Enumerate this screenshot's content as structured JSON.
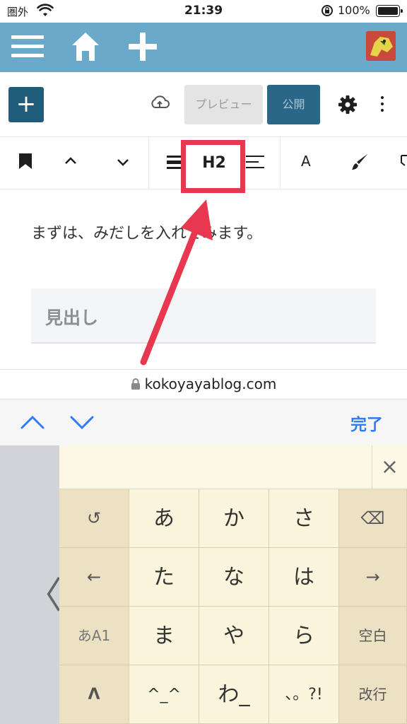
{
  "status": {
    "carrier": "圏外",
    "time": "21:39",
    "battery": "100%"
  },
  "adminbar": {
    "menu_icon": "hamburger-menu-icon",
    "home_icon": "home-icon",
    "add_icon": "plus-icon",
    "background": "#6aa9c9"
  },
  "editor_header": {
    "add_block": "+",
    "preview": "プレビュー",
    "publish": "公開"
  },
  "block_toolbar": {
    "heading_level": "H2",
    "text_color": "A"
  },
  "content": {
    "paragraph": "まずは、みだしを入れてみます。",
    "heading_placeholder": "見出し"
  },
  "browser": {
    "url": "kokoyayablog.com"
  },
  "accessory": {
    "done": "完了"
  },
  "keyboard": {
    "rows": [
      [
        "↺",
        "あ",
        "か",
        "さ",
        "⌫"
      ],
      [
        "←",
        "た",
        "な",
        "は",
        "→"
      ],
      [
        "あA1",
        "ま",
        "や",
        "ら",
        "空白"
      ],
      [
        "Λ",
        "^_^",
        "わ_",
        "、。?!",
        "改行"
      ]
    ],
    "prev_candidate": "〈",
    "close": "×"
  },
  "colors": {
    "highlight": "#e8384f",
    "primary": "#2a6688",
    "link": "#2f7cf6"
  }
}
